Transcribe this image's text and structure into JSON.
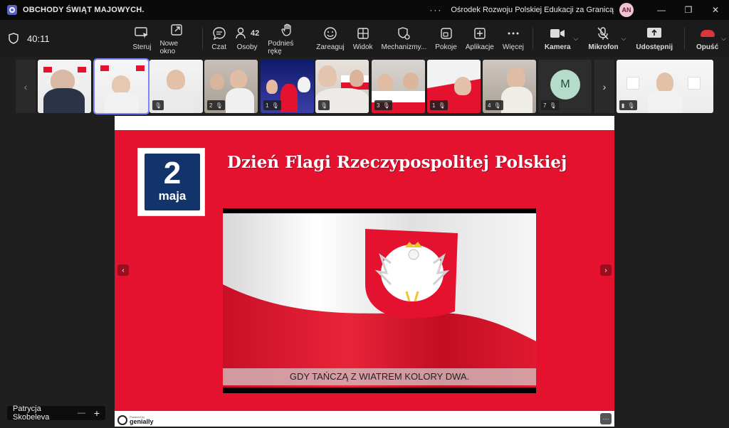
{
  "window": {
    "meeting_title": "OBCHODY ŚWIĄT MAJOWYCH.",
    "more": "···",
    "org": "Ośrodek Rozwoju Polskiej Edukacji za Granicą",
    "avatar_initials": "AN",
    "minimize": "—",
    "restore": "❐",
    "close": "✕"
  },
  "toolbar": {
    "timer": "40:11",
    "people_count": "42",
    "items": {
      "control": "Steruj",
      "new_window": "Nowe okno",
      "chat": "Czat",
      "people": "Osoby",
      "raise_hand": "Podnieś rękę",
      "react": "Zareaguj",
      "view": "Widok",
      "mechanisms": "Mechanizmy...",
      "rooms": "Pokoje",
      "apps": "Aplikacje",
      "more": "Więcej",
      "camera": "Kamera",
      "mic": "Mikrofon",
      "share": "Udostępnij",
      "leave": "Opuść"
    },
    "chevron": "⌵"
  },
  "strip": {
    "prev": "‹",
    "next": "›",
    "avatar_letter": "M",
    "tiles": [
      {
        "badge": ""
      },
      {
        "badge": ""
      },
      {
        "badge": ""
      },
      {
        "badge": "2"
      },
      {
        "badge": "1"
      },
      {
        "badge": ""
      },
      {
        "badge": "3"
      },
      {
        "badge": "1"
      },
      {
        "badge": "4"
      },
      {
        "badge": "7"
      },
      {
        "badge": ""
      }
    ]
  },
  "slide": {
    "badge_num": "2",
    "badge_word": "maja",
    "title": "Dzień Flagi Rzeczypospolitej Polskiej",
    "caption": "GDY TAŃCZĄ Z WIATREM KOLORY DWA.",
    "prev": "‹",
    "next": "›",
    "brand_small": "Powered by",
    "brand": "genially",
    "more": "···"
  },
  "name_chip": {
    "name": "Patrycja Skobeleva",
    "separator": "—",
    "plus": "+"
  },
  "colors": {
    "red": "#e4112f",
    "white": "#ffffff",
    "navy": "#13346a",
    "accent": "#7f85f5"
  }
}
